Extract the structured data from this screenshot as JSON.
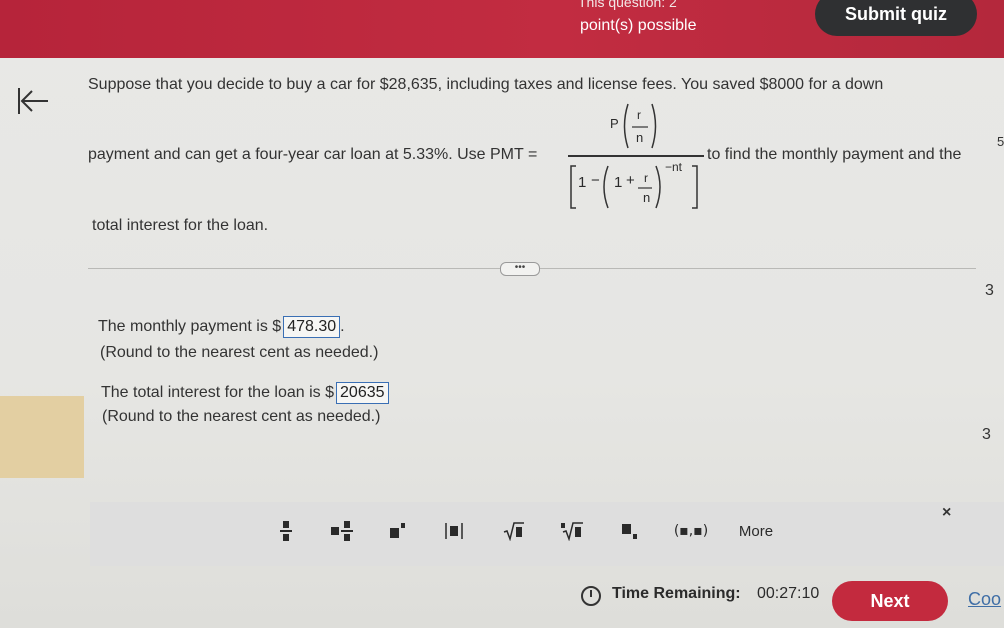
{
  "header": {
    "question_label": "This question: 2",
    "points": "point(s) possible",
    "submit_label": "Submit quiz"
  },
  "question": {
    "line1": "Suppose that you decide to buy a car for $28,635, including taxes and license fees. You saved $8000 for a down",
    "line2_before": "payment and can get a four-year car loan at 5.33%. Use PMT =",
    "line2_after": "to find the monthly payment and the",
    "line3": "total interest for the loan.",
    "formula": {
      "numerator_P": "P",
      "r": "r",
      "n": "n",
      "one": "1",
      "minus": "−",
      "plus": "+",
      "exponent": "−nt"
    }
  },
  "side_numbers": {
    "right_top": "3",
    "right_mid": "3",
    "edge": "5"
  },
  "answers": {
    "monthly_prefix": "The monthly payment is $",
    "monthly_value": "478.30",
    "monthly_suffix": ".",
    "round1": "(Round to the nearest cent as needed.)",
    "interest_prefix": "The total interest for the loan is $",
    "interest_value": "20635",
    "round2": "(Round to the nearest cent as needed.)"
  },
  "toolbar": {
    "items": [
      "fraction-icon",
      "mixed-number-icon",
      "exponent-icon",
      "absolute-value-icon",
      "square-root-icon",
      "nth-root-icon",
      "subscript-icon",
      "ordered-pair-icon"
    ],
    "ordered_pair_label": "(▪,▪)",
    "more_label": "More",
    "close_label": "×"
  },
  "footer": {
    "time_label": "Time Remaining:",
    "time_value": "00:27:10",
    "next_label": "Next",
    "cookie_label": "Coo"
  }
}
